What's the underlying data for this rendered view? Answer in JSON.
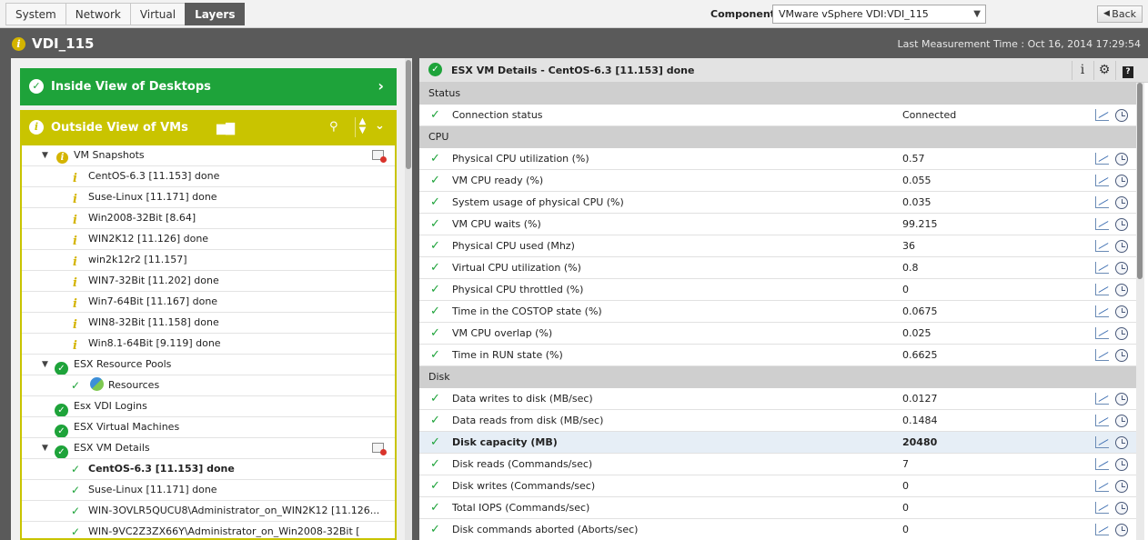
{
  "tabs": [
    {
      "label": "System",
      "active": false
    },
    {
      "label": "Network",
      "active": false
    },
    {
      "label": "Virtual",
      "active": false
    },
    {
      "label": "Layers",
      "active": true
    }
  ],
  "component": {
    "label": "Component",
    "value": "VMware vSphere VDI:VDI_115"
  },
  "back_label": "Back",
  "page_title": "VDI_115",
  "measurement_time": "Last Measurement Time : Oct 16, 2014 17:29:54",
  "left": {
    "inside_view": "Inside View of Desktops",
    "outside_view": "Outside View of VMs",
    "tree": {
      "snapshots": {
        "label": "VM Snapshots",
        "items": [
          "CentOS-6.3 [11.153] done",
          "Suse-Linux [11.171] done",
          "Win2008-32Bit [8.64]",
          "WIN2K12 [11.126] done",
          "win2k12r2 [11.157]",
          "WIN7-32Bit [11.202] done",
          "Win7-64Bit [11.167] done",
          "WIN8-32Bit [11.158] done",
          "Win8.1-64Bit [9.119] done"
        ]
      },
      "pools": {
        "label": "ESX Resource Pools",
        "items": [
          "Resources"
        ]
      },
      "logins": "Esx VDI Logins",
      "machines": "ESX Virtual Machines",
      "details": {
        "label": "ESX VM Details",
        "items": [
          "CentOS-6.3 [11.153] done",
          "Suse-Linux [11.171] done",
          "WIN-3OVLR5QUCU8\\Administrator_on_WIN2K12 [11.126...",
          "WIN-9VC2Z3ZX66Y\\Administrator_on_Win2008-32Bit ["
        ]
      }
    }
  },
  "right": {
    "title": "ESX VM Details - CentOS-6.3 [11.153] done",
    "sections": [
      {
        "name": "Status",
        "rows": [
          {
            "name": "Connection status",
            "value": "Connected"
          }
        ]
      },
      {
        "name": "CPU",
        "rows": [
          {
            "name": "Physical CPU utilization (%)",
            "value": "0.57"
          },
          {
            "name": "VM CPU ready (%)",
            "value": "0.055"
          },
          {
            "name": "System usage of physical CPU (%)",
            "value": "0.035"
          },
          {
            "name": "VM CPU waits (%)",
            "value": "99.215"
          },
          {
            "name": "Physical CPU used (Mhz)",
            "value": "36"
          },
          {
            "name": "Virtual CPU utilization (%)",
            "value": "0.8"
          },
          {
            "name": "Physical CPU throttled (%)",
            "value": "0"
          },
          {
            "name": "Time in the COSTOP state (%)",
            "value": "0.0675"
          },
          {
            "name": "VM CPU overlap (%)",
            "value": "0.025"
          },
          {
            "name": "Time in RUN state (%)",
            "value": "0.6625"
          }
        ]
      },
      {
        "name": "Disk",
        "rows": [
          {
            "name": "Data writes to disk (MB/sec)",
            "value": "0.0127"
          },
          {
            "name": "Data reads from disk (MB/sec)",
            "value": "0.1484"
          },
          {
            "name": "Disk capacity (MB)",
            "value": "20480",
            "highlight": true
          },
          {
            "name": "Disk reads (Commands/sec)",
            "value": "7"
          },
          {
            "name": "Disk writes (Commands/sec)",
            "value": "0"
          },
          {
            "name": "Total IOPS (Commands/sec)",
            "value": "0"
          },
          {
            "name": "Disk commands aborted (Aborts/sec)",
            "value": "0"
          }
        ]
      }
    ]
  },
  "colors": {
    "green": "#1ea33a",
    "olive": "#c9c400",
    "header_gray": "#5a5a5a"
  }
}
